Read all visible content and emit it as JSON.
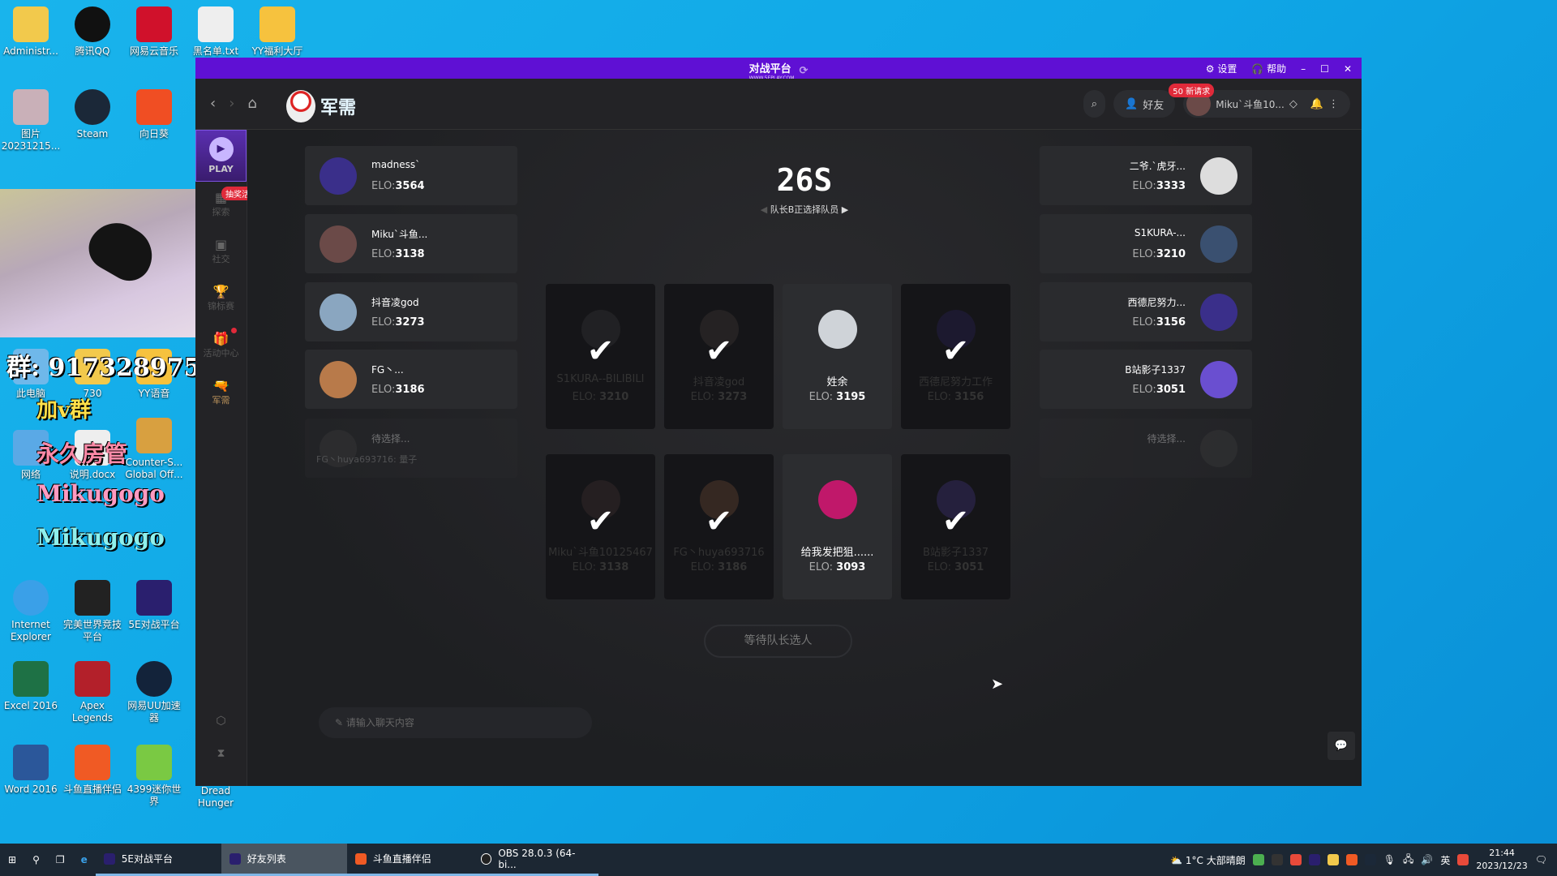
{
  "desktop": {
    "icons": [
      "Administr...",
      "腾讯QQ",
      "网易云音乐",
      "黑名单.txt",
      "YY福利大厅",
      "图片 20231215...",
      "Steam",
      "向日葵",
      "此电脑",
      "730",
      "YY语音",
      "网络",
      "说明.docx",
      "Counter-S... Global Off...",
      "Internet Explorer",
      "完美世界竞技平台",
      "5E对战平台",
      "Excel 2016",
      "Apex Legends",
      "网易UU加速器",
      "Word 2016",
      "斗鱼直播伴侣",
      "4399迷你世界",
      "Dread Hunger"
    ],
    "overlay": {
      "group": "群: 917328975",
      "addv": "加v群",
      "admin": "永久房管",
      "bili": "Mikugogo",
      "douyin": "Mikugogo"
    }
  },
  "titlebar": {
    "logo": "对战平台",
    "logo_url": "WWW.5EPLAY.COM",
    "settings": "设置",
    "help": "帮助"
  },
  "header": {
    "page_title": "军需",
    "friends": "好友",
    "friend_badge": "50 新请求",
    "user": "Miku`斗鱼10..."
  },
  "sidebar": {
    "play": "PLAY",
    "items": [
      {
        "label": "探索",
        "badge": "抽奖活动"
      },
      {
        "label": "社交"
      },
      {
        "label": "锦标赛"
      },
      {
        "label": "活动中心"
      },
      {
        "label": "军需"
      }
    ]
  },
  "draft": {
    "timer": "26S",
    "status": "队长B正选择队员",
    "team_a": [
      {
        "name": "madness`",
        "elo": "3564"
      },
      {
        "name": "Miku`斗鱼...",
        "elo": "3138"
      },
      {
        "name": "抖音凌god",
        "elo": "3273"
      },
      {
        "name": "FG丶...",
        "elo": "3186"
      },
      {
        "name": "待选择...",
        "note": "FG丶huya693716: 量子"
      }
    ],
    "team_b": [
      {
        "name": "二爷.`虎牙...",
        "elo": "3333"
      },
      {
        "name": "S1KURA-...",
        "elo": "3210"
      },
      {
        "name": "西德尼努力...",
        "elo": "3156"
      },
      {
        "name": "B站影子1337",
        "elo": "3051"
      },
      {
        "name": "待选择..."
      }
    ],
    "elo_label": "ELO:",
    "pool": [
      {
        "name": "S1KURA--BILIBILI",
        "elo": "3210",
        "picked": true
      },
      {
        "name": "抖音凌god",
        "elo": "3273",
        "picked": true
      },
      {
        "name": "姓余",
        "elo": "3195",
        "picked": false
      },
      {
        "name": "西德尼努力工作",
        "elo": "3156",
        "picked": true
      },
      {
        "name": "Miku`斗鱼10125467",
        "elo": "3138",
        "picked": true
      },
      {
        "name": "FG丶huya693716",
        "elo": "3186",
        "picked": true
      },
      {
        "name": "给我发把狙......",
        "elo": "3093",
        "picked": false
      },
      {
        "name": "B站影子1337",
        "elo": "3051",
        "picked": true
      }
    ],
    "wait_button": "等待队长选人",
    "chat_placeholder": "请输入聊天内容"
  },
  "taskbar": {
    "apps": [
      "5E对战平台",
      "好友列表",
      "斗鱼直播伴侣",
      "OBS 28.0.3 (64-bi..."
    ],
    "weather": "1°C 大部晴朗",
    "ime": "英",
    "time": "21:44",
    "date": "2023/12/23"
  },
  "colors": {
    "titlebar": "#5f10d4",
    "accent": "#7b52e0",
    "badge": "#e02a3a",
    "active_nav": "#e8b45a"
  }
}
